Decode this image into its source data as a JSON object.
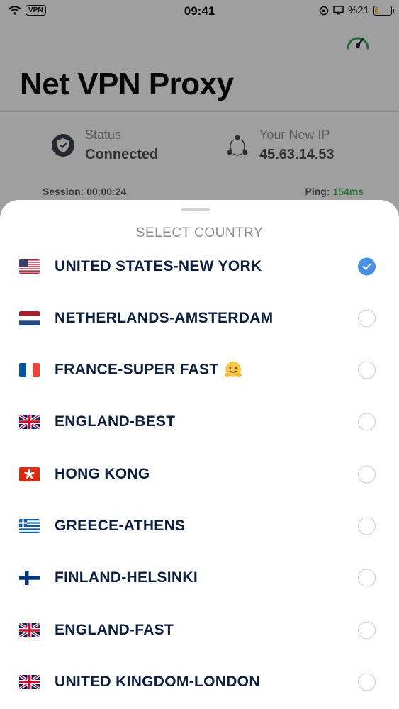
{
  "status_bar": {
    "time": "09:41",
    "vpn_badge": "VPN",
    "battery_text": "%21",
    "battery_level": 0.21
  },
  "header": {
    "title": "Net VPN Proxy"
  },
  "info": {
    "status_label": "Status",
    "status_value": "Connected",
    "ip_label": "Your New IP",
    "ip_value": "45.63.14.53",
    "session_text": "Session: 00:00:24",
    "ping_label": "Ping:",
    "ping_value": "154ms"
  },
  "colors": {
    "accent": "#4a90e2",
    "ping_good": "#43b25a",
    "country_text": "#0d1f3f"
  },
  "sheet": {
    "title": "SELECT COUNTRY",
    "countries": [
      {
        "label": "UNITED STATES-NEW YORK",
        "flag": "us-flag",
        "selected": true
      },
      {
        "label": "NETHERLANDS-AMSTERDAM",
        "flag": "nl-flag",
        "selected": false
      },
      {
        "label": "FRANCE-SUPER FAST",
        "flag": "fr-flag",
        "selected": false,
        "emoji": "hugging-face-emoji"
      },
      {
        "label": "ENGLAND-BEST",
        "flag": "uk-flag",
        "selected": false
      },
      {
        "label": "HONG KONG",
        "flag": "hk-flag",
        "selected": false
      },
      {
        "label": "GREECE-ATHENS",
        "flag": "gr-flag",
        "selected": false
      },
      {
        "label": "FINLAND-HELSINKI",
        "flag": "fi-flag",
        "selected": false
      },
      {
        "label": "ENGLAND-FAST",
        "flag": "uk-flag",
        "selected": false
      },
      {
        "label": "UNITED KINGDOM-LONDON",
        "flag": "uk-flag",
        "selected": false
      }
    ]
  }
}
